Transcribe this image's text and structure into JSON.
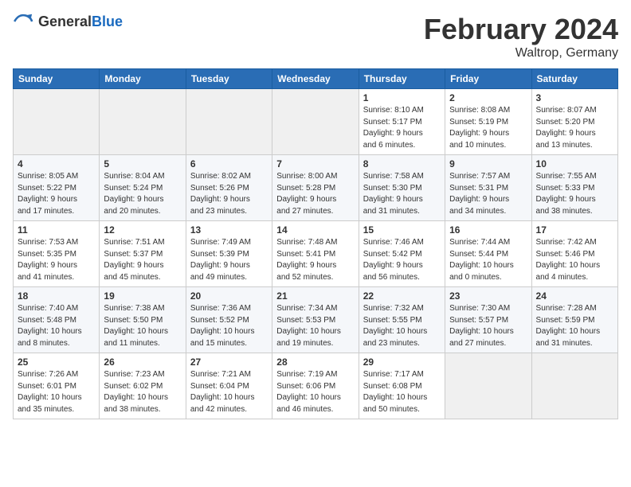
{
  "header": {
    "logo_general": "General",
    "logo_blue": "Blue",
    "title": "February 2024",
    "subtitle": "Waltrop, Germany"
  },
  "columns": [
    "Sunday",
    "Monday",
    "Tuesday",
    "Wednesday",
    "Thursday",
    "Friday",
    "Saturday"
  ],
  "weeks": [
    [
      {
        "day": "",
        "info": ""
      },
      {
        "day": "",
        "info": ""
      },
      {
        "day": "",
        "info": ""
      },
      {
        "day": "",
        "info": ""
      },
      {
        "day": "1",
        "info": "Sunrise: 8:10 AM\nSunset: 5:17 PM\nDaylight: 9 hours\nand 6 minutes."
      },
      {
        "day": "2",
        "info": "Sunrise: 8:08 AM\nSunset: 5:19 PM\nDaylight: 9 hours\nand 10 minutes."
      },
      {
        "day": "3",
        "info": "Sunrise: 8:07 AM\nSunset: 5:20 PM\nDaylight: 9 hours\nand 13 minutes."
      }
    ],
    [
      {
        "day": "4",
        "info": "Sunrise: 8:05 AM\nSunset: 5:22 PM\nDaylight: 9 hours\nand 17 minutes."
      },
      {
        "day": "5",
        "info": "Sunrise: 8:04 AM\nSunset: 5:24 PM\nDaylight: 9 hours\nand 20 minutes."
      },
      {
        "day": "6",
        "info": "Sunrise: 8:02 AM\nSunset: 5:26 PM\nDaylight: 9 hours\nand 23 minutes."
      },
      {
        "day": "7",
        "info": "Sunrise: 8:00 AM\nSunset: 5:28 PM\nDaylight: 9 hours\nand 27 minutes."
      },
      {
        "day": "8",
        "info": "Sunrise: 7:58 AM\nSunset: 5:30 PM\nDaylight: 9 hours\nand 31 minutes."
      },
      {
        "day": "9",
        "info": "Sunrise: 7:57 AM\nSunset: 5:31 PM\nDaylight: 9 hours\nand 34 minutes."
      },
      {
        "day": "10",
        "info": "Sunrise: 7:55 AM\nSunset: 5:33 PM\nDaylight: 9 hours\nand 38 minutes."
      }
    ],
    [
      {
        "day": "11",
        "info": "Sunrise: 7:53 AM\nSunset: 5:35 PM\nDaylight: 9 hours\nand 41 minutes."
      },
      {
        "day": "12",
        "info": "Sunrise: 7:51 AM\nSunset: 5:37 PM\nDaylight: 9 hours\nand 45 minutes."
      },
      {
        "day": "13",
        "info": "Sunrise: 7:49 AM\nSunset: 5:39 PM\nDaylight: 9 hours\nand 49 minutes."
      },
      {
        "day": "14",
        "info": "Sunrise: 7:48 AM\nSunset: 5:41 PM\nDaylight: 9 hours\nand 52 minutes."
      },
      {
        "day": "15",
        "info": "Sunrise: 7:46 AM\nSunset: 5:42 PM\nDaylight: 9 hours\nand 56 minutes."
      },
      {
        "day": "16",
        "info": "Sunrise: 7:44 AM\nSunset: 5:44 PM\nDaylight: 10 hours\nand 0 minutes."
      },
      {
        "day": "17",
        "info": "Sunrise: 7:42 AM\nSunset: 5:46 PM\nDaylight: 10 hours\nand 4 minutes."
      }
    ],
    [
      {
        "day": "18",
        "info": "Sunrise: 7:40 AM\nSunset: 5:48 PM\nDaylight: 10 hours\nand 8 minutes."
      },
      {
        "day": "19",
        "info": "Sunrise: 7:38 AM\nSunset: 5:50 PM\nDaylight: 10 hours\nand 11 minutes."
      },
      {
        "day": "20",
        "info": "Sunrise: 7:36 AM\nSunset: 5:52 PM\nDaylight: 10 hours\nand 15 minutes."
      },
      {
        "day": "21",
        "info": "Sunrise: 7:34 AM\nSunset: 5:53 PM\nDaylight: 10 hours\nand 19 minutes."
      },
      {
        "day": "22",
        "info": "Sunrise: 7:32 AM\nSunset: 5:55 PM\nDaylight: 10 hours\nand 23 minutes."
      },
      {
        "day": "23",
        "info": "Sunrise: 7:30 AM\nSunset: 5:57 PM\nDaylight: 10 hours\nand 27 minutes."
      },
      {
        "day": "24",
        "info": "Sunrise: 7:28 AM\nSunset: 5:59 PM\nDaylight: 10 hours\nand 31 minutes."
      }
    ],
    [
      {
        "day": "25",
        "info": "Sunrise: 7:26 AM\nSunset: 6:01 PM\nDaylight: 10 hours\nand 35 minutes."
      },
      {
        "day": "26",
        "info": "Sunrise: 7:23 AM\nSunset: 6:02 PM\nDaylight: 10 hours\nand 38 minutes."
      },
      {
        "day": "27",
        "info": "Sunrise: 7:21 AM\nSunset: 6:04 PM\nDaylight: 10 hours\nand 42 minutes."
      },
      {
        "day": "28",
        "info": "Sunrise: 7:19 AM\nSunset: 6:06 PM\nDaylight: 10 hours\nand 46 minutes."
      },
      {
        "day": "29",
        "info": "Sunrise: 7:17 AM\nSunset: 6:08 PM\nDaylight: 10 hours\nand 50 minutes."
      },
      {
        "day": "",
        "info": ""
      },
      {
        "day": "",
        "info": ""
      }
    ]
  ]
}
